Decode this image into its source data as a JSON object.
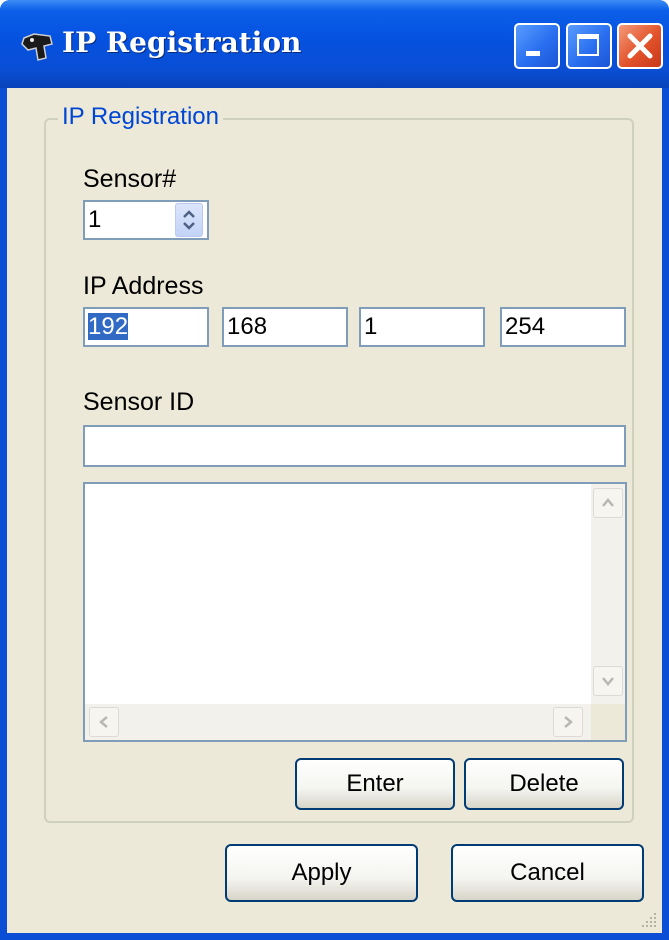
{
  "window": {
    "title": "IP Registration",
    "controls": [
      "minimize-icon",
      "maximize-icon",
      "close-icon"
    ]
  },
  "group": {
    "title": "IP Registration",
    "sensor_number": {
      "label": "Sensor#",
      "value": "1"
    },
    "ip_address": {
      "label": "IP Address",
      "octets": [
        "192",
        "168",
        "1",
        "254"
      ]
    },
    "sensor_id": {
      "label": "Sensor ID",
      "value": ""
    },
    "list": {
      "items": []
    },
    "buttons": {
      "enter": "Enter",
      "delete": "Delete"
    }
  },
  "footer": {
    "apply": "Apply",
    "cancel": "Cancel"
  },
  "colors": {
    "title_blue": "#0a4ed6",
    "group_title": "#0046d5",
    "dialog_bg": "#ece9d8"
  }
}
